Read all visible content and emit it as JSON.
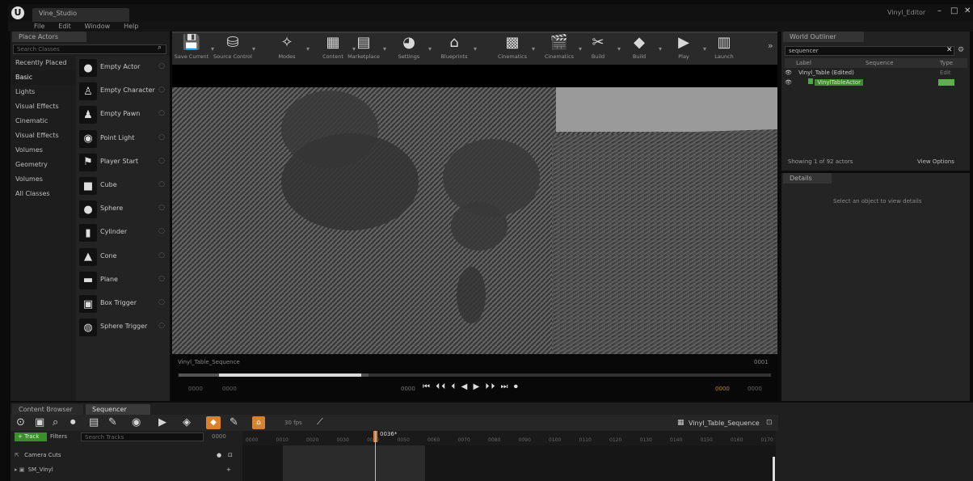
{
  "window": {
    "app_logo": "U",
    "tab_title": "Vine_Studio",
    "project_name": "Vinyl_Editor",
    "controls": [
      "–",
      "□",
      "✕"
    ]
  },
  "menu": [
    "File",
    "Edit",
    "Window",
    "Help"
  ],
  "place_actors": {
    "tab": "Place Actors",
    "search_placeholder": "Search Classes",
    "categories": [
      "Recently Placed",
      "Basic",
      "Lights",
      "Visual Effects",
      "Cinematic",
      "Visual Effects",
      "Volumes",
      "Geometry",
      "Volumes",
      "All Classes"
    ],
    "selected_category": "Basic",
    "items": [
      {
        "label": "Empty Actor",
        "icon": "sphere-icon",
        "glyph": "●"
      },
      {
        "label": "Empty Character",
        "icon": "character-icon",
        "glyph": "♙"
      },
      {
        "label": "Empty Pawn",
        "icon": "pawn-icon",
        "glyph": "♟"
      },
      {
        "label": "Point Light",
        "icon": "bulb-icon",
        "glyph": "◉"
      },
      {
        "label": "Player Start",
        "icon": "player-start-icon",
        "glyph": "⚑"
      },
      {
        "label": "Cube",
        "icon": "cube-icon",
        "glyph": "■"
      },
      {
        "label": "Sphere",
        "icon": "sphere-icon",
        "glyph": "●"
      },
      {
        "label": "Cylinder",
        "icon": "cylinder-icon",
        "glyph": "▮"
      },
      {
        "label": "Cone",
        "icon": "cone-icon",
        "glyph": "▲"
      },
      {
        "label": "Plane",
        "icon": "plane-icon",
        "glyph": "▬"
      },
      {
        "label": "Box Trigger",
        "icon": "box-trigger-icon",
        "glyph": "▣"
      },
      {
        "label": "Sphere Trigger",
        "icon": "sphere-trigger-icon",
        "glyph": "◍"
      }
    ]
  },
  "toolbar": [
    {
      "label": "Save Current",
      "icon": "save-icon",
      "glyph": "💾"
    },
    {
      "label": "Source Control",
      "icon": "source-control-icon",
      "glyph": "⛁"
    },
    {
      "label": "Modes",
      "icon": "modes-icon",
      "glyph": "✧"
    },
    {
      "label": "Content",
      "icon": "content-icon",
      "glyph": "▦"
    },
    {
      "label": "Marketplace",
      "icon": "marketplace-icon",
      "glyph": "▤"
    },
    {
      "label": "Settings",
      "icon": "settings-icon",
      "glyph": "◕"
    },
    {
      "label": "Blueprints",
      "icon": "blueprints-icon",
      "glyph": "⌂"
    },
    {
      "label": "Cinematics",
      "icon": "cinematics-icon",
      "glyph": "▩"
    },
    {
      "label": "Cinematics",
      "icon": "clapper-icon",
      "glyph": "🎬"
    },
    {
      "label": "Build",
      "icon": "build-icon",
      "glyph": "✂"
    },
    {
      "label": "Build",
      "icon": "build-cube-icon",
      "glyph": "◆"
    },
    {
      "label": "Play",
      "icon": "play-icon",
      "glyph": "▶"
    },
    {
      "label": "Launch",
      "icon": "launch-icon",
      "glyph": "▥"
    }
  ],
  "viewport": {
    "sequence_name": "Vinyl_Table_Sequence",
    "frame_right": "0001",
    "frame_left_a": "0000",
    "frame_left_b": "0000",
    "transport_label": "0000",
    "frame_right_a": "0000",
    "frame_right_b": "0000",
    "transport": [
      "⏮",
      "⏴⏴",
      "⏴",
      "◀",
      "▶",
      "⏵⏵",
      "⏭",
      "⏺"
    ],
    "progress": 0.24,
    "buffer": 0.32
  },
  "world_outliner": {
    "tab": "World Outliner",
    "search_value": "sequencer",
    "columns": [
      "Label",
      "Sequence",
      "Type"
    ],
    "rows": [
      {
        "label": "Vinyl_Table (Edited)",
        "type": "Edit"
      },
      {
        "label": "VinylTableActor",
        "type": ""
      }
    ],
    "status": "Showing 1 of 92 actors",
    "view_options": "View Options"
  },
  "details": {
    "tab": "Details",
    "empty_msg": "Select an object to view details"
  },
  "bottom_tabs": [
    "Content Browser",
    "Sequencer"
  ],
  "sequencer": {
    "sequence_label": "Vinyl_Table_Sequence",
    "fps_label": "30 fps",
    "track_button": "+ Track",
    "filter_label": "Filters",
    "search_placeholder": "Search Tracks",
    "current_frame": "0036*",
    "frame_box": "0000",
    "ticks": [
      "0000",
      "0010",
      "0020",
      "0030",
      "0040",
      "0050",
      "0060",
      "0070",
      "0080",
      "0090",
      "0100",
      "0110",
      "0120",
      "0130",
      "0140",
      "0150",
      "0160",
      "0170"
    ],
    "tracks": [
      "Camera Cuts",
      "SM_Vinyl"
    ]
  }
}
